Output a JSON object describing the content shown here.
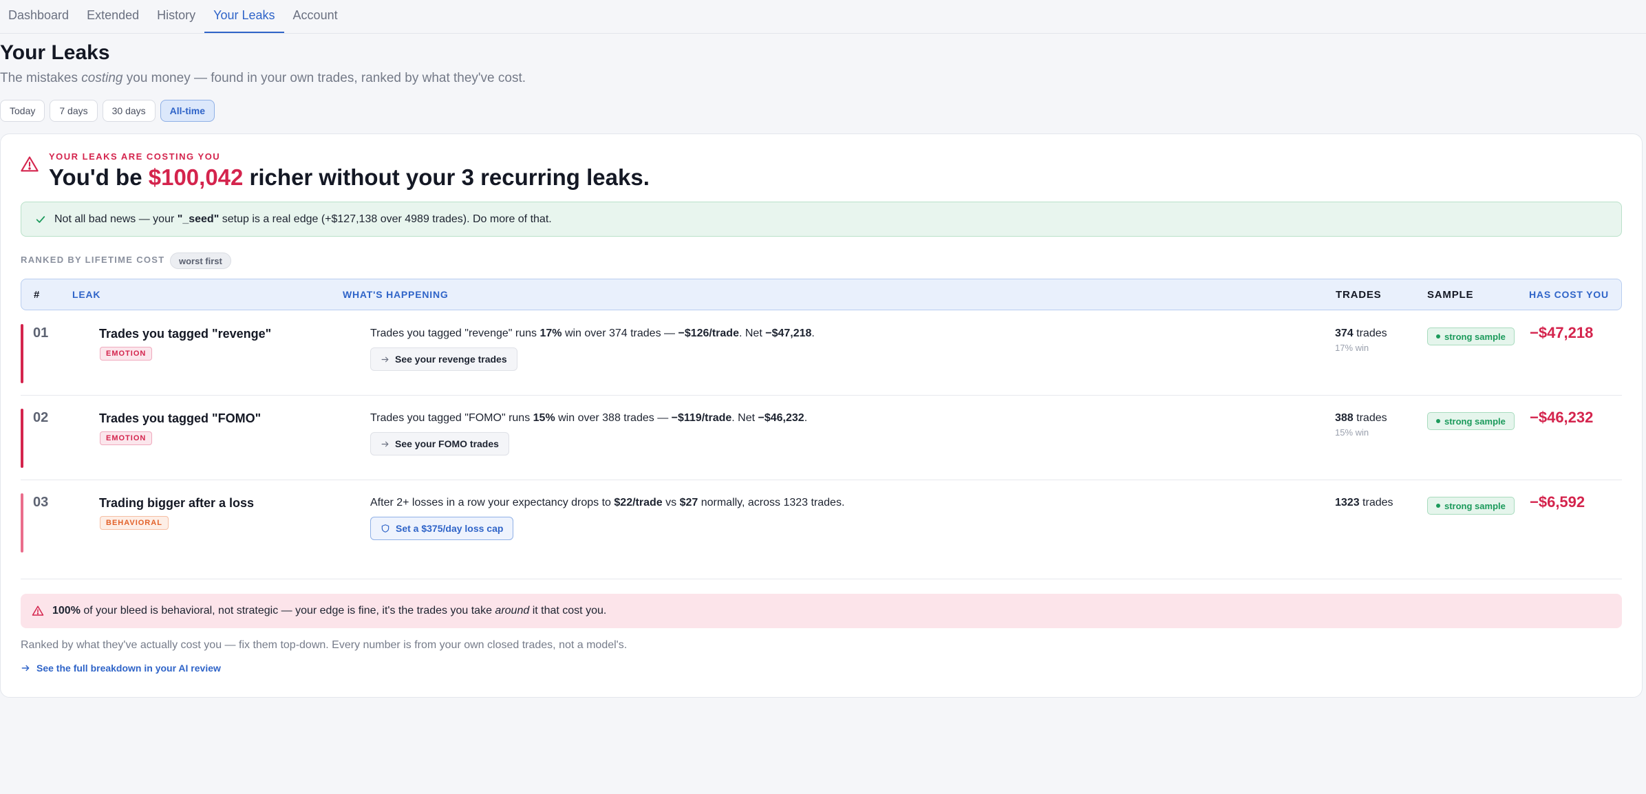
{
  "nav": {
    "tabs": [
      {
        "label": "Dashboard"
      },
      {
        "label": "Extended"
      },
      {
        "label": "History"
      },
      {
        "label": "Your Leaks"
      },
      {
        "label": "Account"
      }
    ],
    "active_tab": "Your Leaks"
  },
  "header": {
    "title": "Your Leaks",
    "subtitle_before": "The mistakes ",
    "subtitle_em": "costing",
    "subtitle_after": " you money — found in your own trades, ranked by what they've cost."
  },
  "ranges": {
    "options": [
      "Today",
      "7 days",
      "30 days",
      "All-time"
    ],
    "selected": "All-time"
  },
  "summary": {
    "kicker": "YOUR LEAKS ARE COSTING YOU",
    "headline_before": "You'd be ",
    "headline_amount": "$100,042",
    "headline_after": " richer without your 3 recurring leaks.",
    "good_news_before": "Not all bad news — your ",
    "good_news_setup": "\"_seed\"",
    "good_news_after": " setup is a real edge (+$127,138 over 4989 trades). Do more of that."
  },
  "ranking": {
    "label": "RANKED BY LIFETIME COST",
    "badge": "worst first"
  },
  "table": {
    "headers": {
      "num": "#",
      "leak": "LEAK",
      "happening": "WHAT'S HAPPENING",
      "trades": "TRADES",
      "sample": "SAMPLE",
      "cost": "HAS COST YOU"
    },
    "rows": [
      {
        "num": "01",
        "title": "Trades you tagged \"revenge\"",
        "tag": "EMOTION",
        "desc": [
          {
            "t": "Trades you tagged \"revenge\" runs "
          },
          {
            "t": "17%",
            "b": true
          },
          {
            "t": " win over 374 trades — "
          },
          {
            "t": "−$126/trade",
            "b": true
          },
          {
            "t": ". Net "
          },
          {
            "t": "−$47,218",
            "b": true
          },
          {
            "t": "."
          }
        ],
        "action": "See your revenge trades",
        "trades_count": "374",
        "trades_word": " trades",
        "win_rate": "17% win",
        "sample": "strong sample",
        "cost": "−$47,218"
      },
      {
        "num": "02",
        "title": "Trades you tagged \"FOMO\"",
        "tag": "EMOTION",
        "desc": [
          {
            "t": "Trades you tagged \"FOMO\" runs "
          },
          {
            "t": "15%",
            "b": true
          },
          {
            "t": " win over 388 trades — "
          },
          {
            "t": "−$119/trade",
            "b": true
          },
          {
            "t": ". Net "
          },
          {
            "t": "−$46,232",
            "b": true
          },
          {
            "t": "."
          }
        ],
        "action": "See your FOMO trades",
        "trades_count": "388",
        "trades_word": " trades",
        "win_rate": "15% win",
        "sample": "strong sample",
        "cost": "−$46,232"
      },
      {
        "num": "03",
        "title": "Trading bigger after a loss",
        "tag": "BEHAVIORAL",
        "desc": [
          {
            "t": "After 2+ losses in a row your expectancy drops to "
          },
          {
            "t": "$22/trade",
            "b": true
          },
          {
            "t": " vs "
          },
          {
            "t": "$27",
            "b": true
          },
          {
            "t": " normally, across 1323 trades."
          }
        ],
        "action": "Set a $375/day loss cap",
        "trades_count": "1323",
        "trades_word": " trades",
        "win_rate": "",
        "sample": "strong sample",
        "cost": "−$6,592"
      }
    ]
  },
  "bleed": {
    "pct": "100%",
    "text_before": " of your bleed is behavioral, not strategic — your edge is fine, it's the trades you take ",
    "text_em": "around",
    "text_after": " it that cost you."
  },
  "footer": {
    "note": "Ranked by what they've actually cost you — fix them top-down. Every number is from your own closed trades, not a model's.",
    "link": "See the full breakdown in your AI review"
  },
  "colors": {
    "accent": "#2f64c8",
    "danger": "#d4244d",
    "success": "#1b9a5b",
    "warning": "#e2612a"
  }
}
